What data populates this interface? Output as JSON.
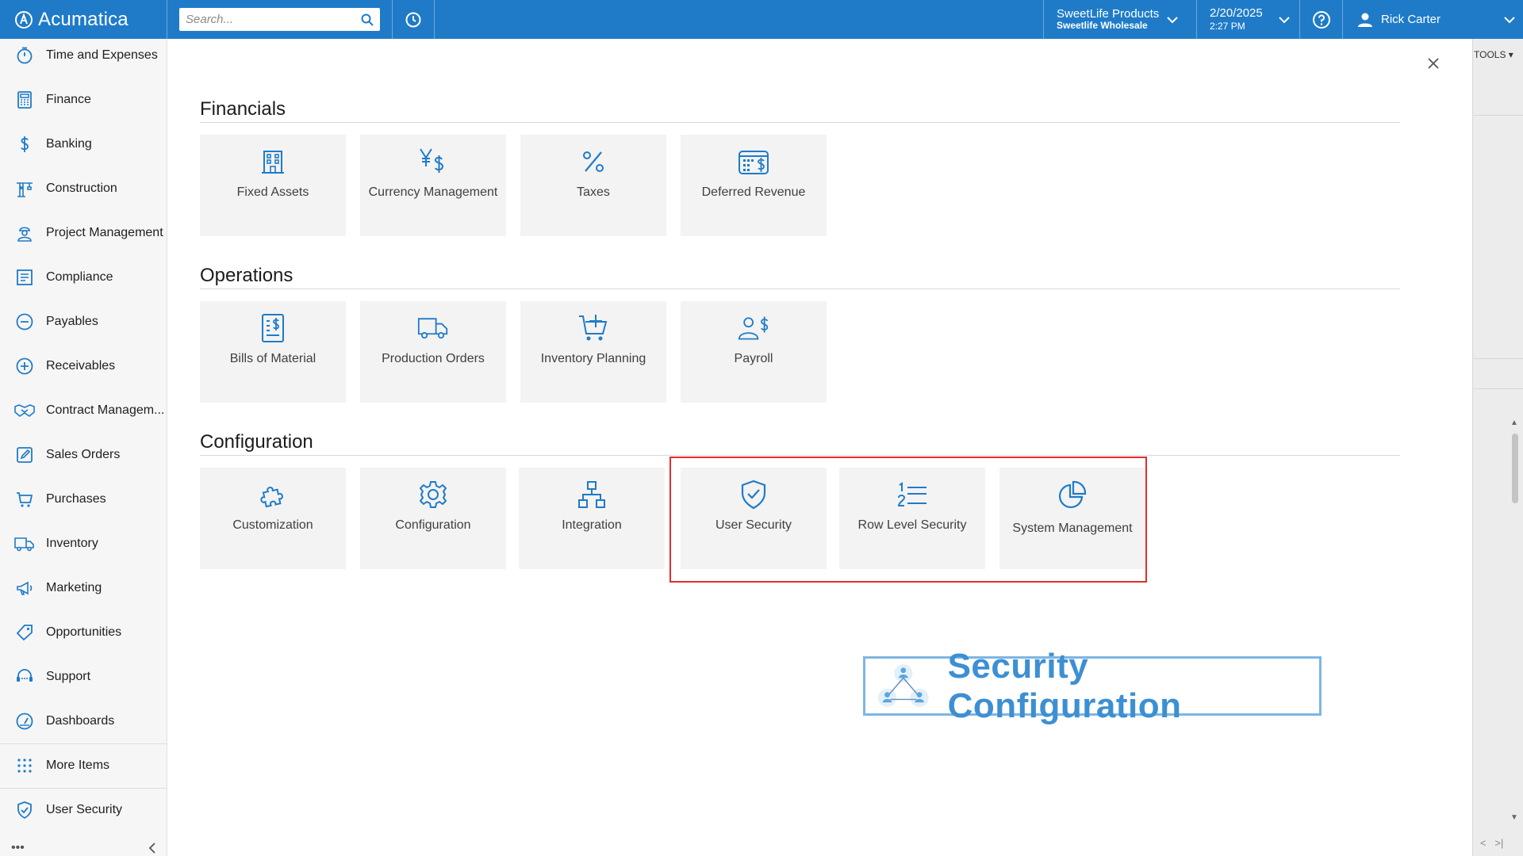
{
  "colors": {
    "brand": "#1f7bc8",
    "highlight": "#e32d2d",
    "banner_text": "#3d8fd3"
  },
  "topbar": {
    "logo": "Acumatica",
    "search_placeholder": "Search...",
    "company_name": "SweetLife Products",
    "company_branch": "Sweetlife Wholesale",
    "date": "2/20/2025",
    "time": "2:27 PM",
    "user": "Rick Carter"
  },
  "sidebar": {
    "items": [
      {
        "label": "Time and Expenses",
        "icon": "stopwatch-icon"
      },
      {
        "label": "Finance",
        "icon": "calculator-icon"
      },
      {
        "label": "Banking",
        "icon": "dollar-icon"
      },
      {
        "label": "Construction",
        "icon": "crane-icon"
      },
      {
        "label": "Project Management",
        "icon": "worker-icon"
      },
      {
        "label": "Compliance",
        "icon": "checklist-icon"
      },
      {
        "label": "Payables",
        "icon": "minus-circle-icon"
      },
      {
        "label": "Receivables",
        "icon": "plus-circle-icon"
      },
      {
        "label": "Contract Managem...",
        "icon": "handshake-icon"
      },
      {
        "label": "Sales Orders",
        "icon": "pencil-note-icon"
      },
      {
        "label": "Purchases",
        "icon": "cart-icon"
      },
      {
        "label": "Inventory",
        "icon": "truck-icon"
      },
      {
        "label": "Marketing",
        "icon": "megaphone-icon"
      },
      {
        "label": "Opportunities",
        "icon": "tag-icon"
      },
      {
        "label": "Support",
        "icon": "headset-icon"
      },
      {
        "label": "Dashboards",
        "icon": "gauge-icon"
      }
    ],
    "more_items": "More Items",
    "pinned": "User Security"
  },
  "sections": [
    {
      "title": "Financials",
      "tiles": [
        {
          "label": "Fixed Assets",
          "icon": "building-icon"
        },
        {
          "label": "Currency Management",
          "icon": "currency-icon"
        },
        {
          "label": "Taxes",
          "icon": "percent-icon"
        },
        {
          "label": "Deferred Revenue",
          "icon": "calendar-dollar-icon"
        }
      ]
    },
    {
      "title": "Operations",
      "tiles": [
        {
          "label": "Bills of Material",
          "icon": "bill-icon"
        },
        {
          "label": "Production Orders",
          "icon": "truck-icon"
        },
        {
          "label": "Inventory Planning",
          "icon": "cart-plus-icon"
        },
        {
          "label": "Payroll",
          "icon": "people-dollar-icon"
        }
      ]
    },
    {
      "title": "Configuration",
      "tiles": [
        {
          "label": "Customization",
          "icon": "puzzle-icon"
        },
        {
          "label": "Configuration",
          "icon": "gear-icon"
        },
        {
          "label": "Integration",
          "icon": "network-icon"
        },
        {
          "label": "User Security",
          "icon": "shield-check-icon"
        },
        {
          "label": "Row Level Security",
          "icon": "numbered-list-icon"
        },
        {
          "label": "System Management",
          "icon": "pie-chart-icon"
        }
      ]
    }
  ],
  "banner": {
    "text": "Security Configuration"
  },
  "right_strip": {
    "tools": "TOOLS"
  }
}
